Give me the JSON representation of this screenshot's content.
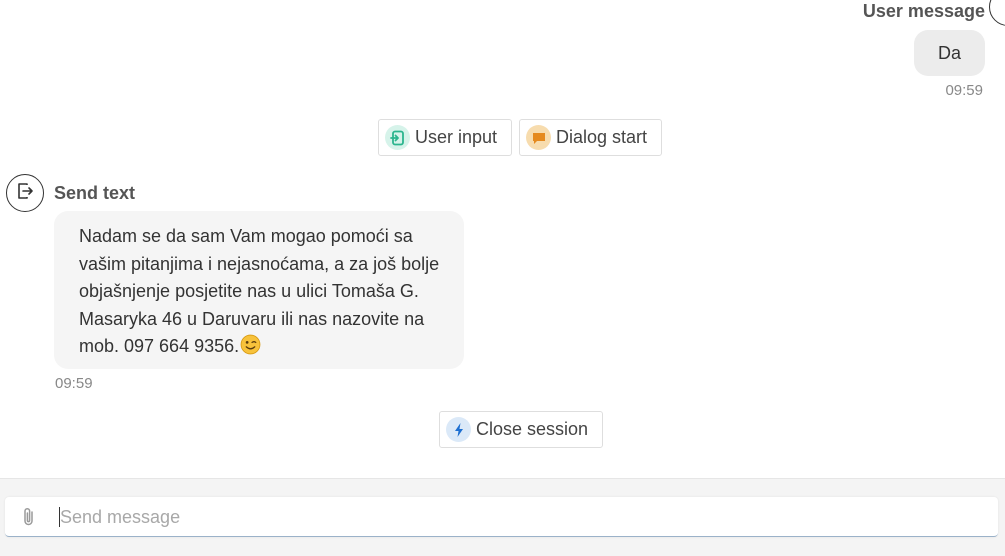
{
  "user_message": {
    "sender_label": "User message",
    "text": "Da",
    "time": "09:59"
  },
  "event_chips": [
    {
      "label": "User input",
      "icon": "user-input-icon",
      "color": "#2bb58e"
    },
    {
      "label": "Dialog start",
      "icon": "dialog-start-icon",
      "color": "#e58a1f"
    }
  ],
  "bot_message": {
    "sender_label": "Send text",
    "lines": [
      "Nadam se da sam Vam mogao pomoći sa",
      "vašim pitanjima i nejasnoćama, a za još bolje",
      "objašnjenje posjetite nas u ulici Tomaša G.",
      "Masaryka 46 u Daruvaru ili nas nazovite na",
      "mob. 097 664 9356."
    ],
    "emoji": "winking-face-emoji",
    "time": "09:59"
  },
  "session_chip": {
    "label": "Close session",
    "icon": "lightning-icon",
    "color": "#1d6fd1"
  },
  "composer": {
    "placeholder": "Send message",
    "value": "",
    "attach_icon": "paperclip-icon"
  }
}
